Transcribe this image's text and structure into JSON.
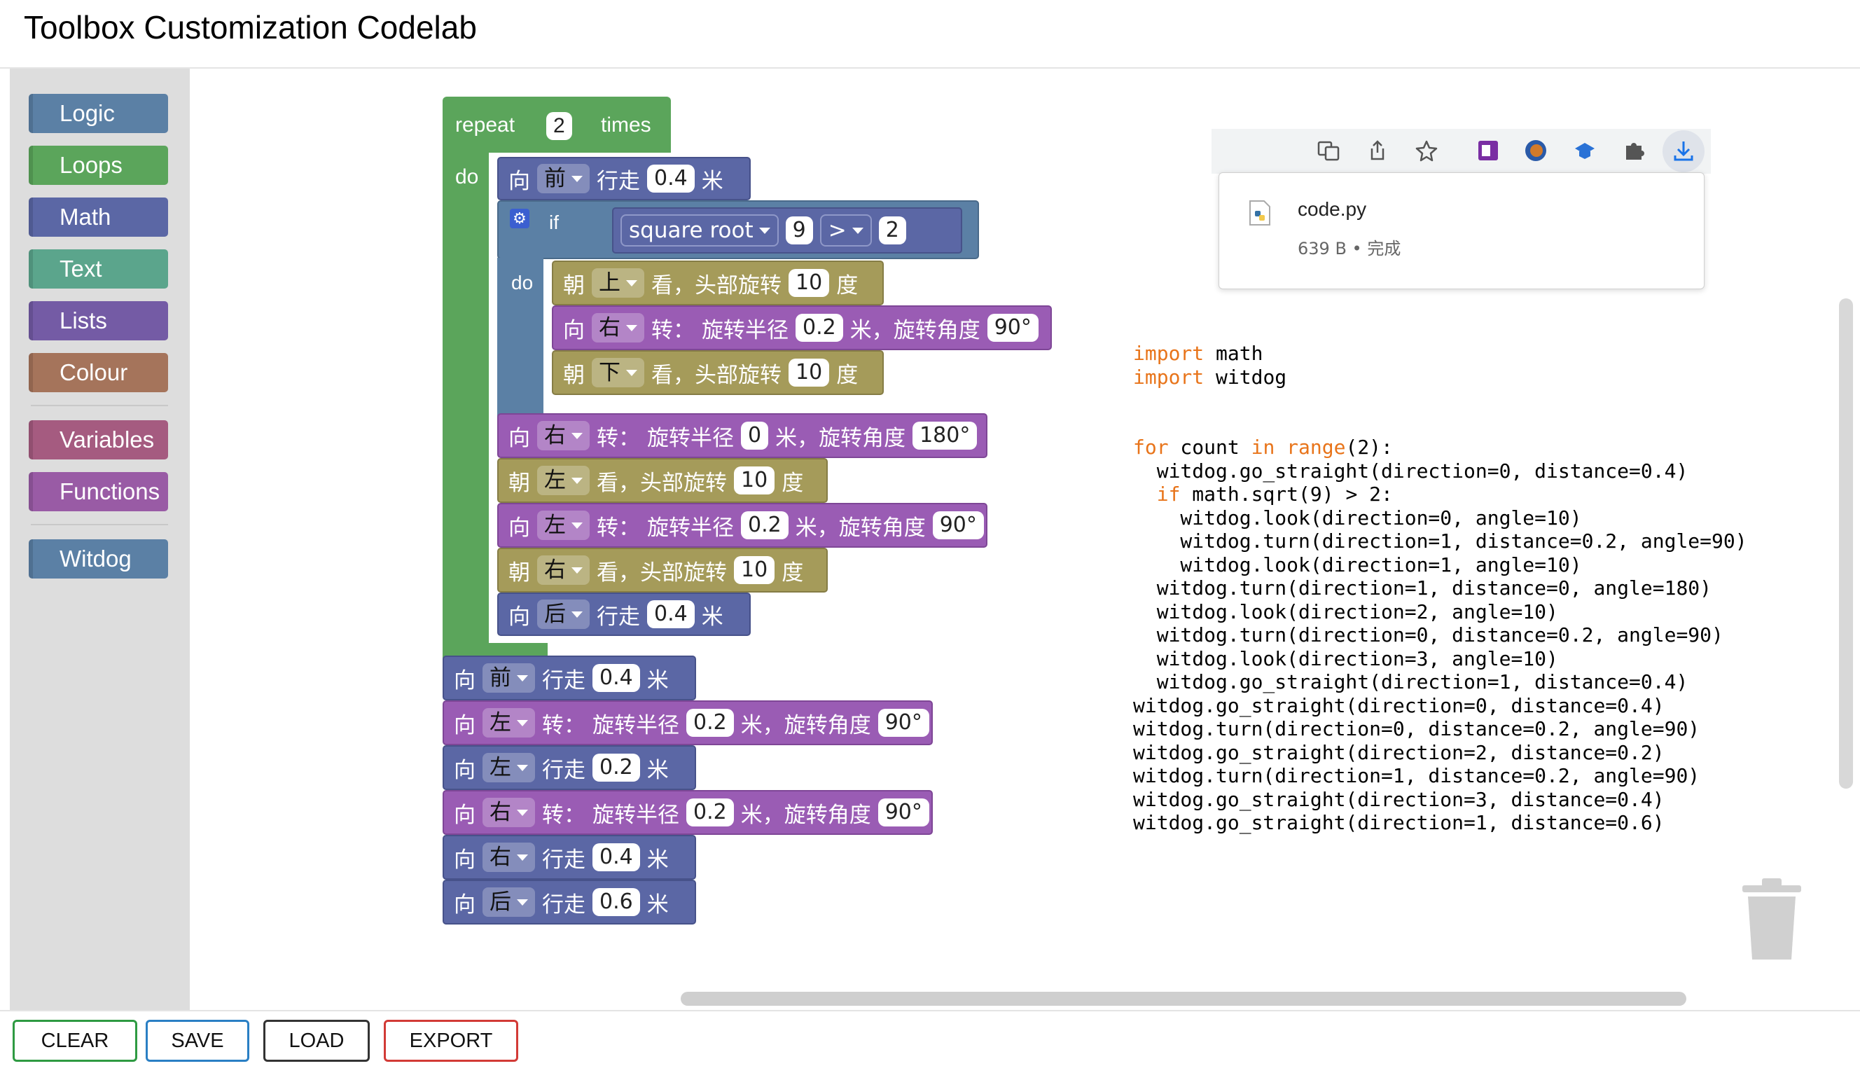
{
  "title": "Toolbox Customization Codelab",
  "toolbox": {
    "categories": [
      {
        "label": "Logic",
        "color": "#5b80a5"
      },
      {
        "label": "Loops",
        "color": "#5ba55b"
      },
      {
        "label": "Math",
        "color": "#5b67a5"
      },
      {
        "label": "Text",
        "color": "#5ba58c"
      },
      {
        "label": "Lists",
        "color": "#745ba5"
      },
      {
        "label": "Colour",
        "color": "#a5745b"
      },
      {
        "label": "Variables",
        "color": "#a55b80"
      },
      {
        "label": "Functions",
        "color": "#995ba5"
      },
      {
        "label": "Witdog",
        "color": "#5b80a5"
      }
    ]
  },
  "blocks": {
    "repeat": {
      "label_repeat": "repeat",
      "count": "2",
      "label_times": "times",
      "label_do": "do"
    },
    "if": {
      "label_if": "if",
      "label_do": "do",
      "func": "square root",
      "arg": "9",
      "op": ">",
      "rhs": "2"
    },
    "words": {
      "xiang": "向",
      "chao": "朝",
      "xingzou": "行走",
      "mi": "米",
      "kan_turn": "看，头部旋转",
      "du": "度",
      "zhuan": "转：",
      "radius": "旋转半径",
      "mi_angle": "米，旋转角度"
    },
    "rows": [
      {
        "dir": "前",
        "dist": "0.4"
      },
      {
        "dir": "上",
        "deg": "10"
      },
      {
        "dir": "右",
        "radius": "0.2",
        "angle": "90°"
      },
      {
        "dir": "下",
        "deg": "10"
      },
      {
        "dir": "右",
        "radius": "0",
        "angle": "180°"
      },
      {
        "dir": "左",
        "deg": "10"
      },
      {
        "dir": "左",
        "radius": "0.2",
        "angle": "90°"
      },
      {
        "dir": "右",
        "deg": "10"
      },
      {
        "dir": "后",
        "dist": "0.4"
      },
      {
        "dir": "前",
        "dist": "0.4"
      },
      {
        "dir": "左",
        "radius": "0.2",
        "angle": "90°"
      },
      {
        "dir": "左",
        "dist": "0.2"
      },
      {
        "dir": "右",
        "radius": "0.2",
        "angle": "90°"
      },
      {
        "dir": "右",
        "dist": "0.4"
      },
      {
        "dir": "后",
        "dist": "0.6"
      }
    ]
  },
  "download": {
    "filename": "code.py",
    "meta": "639 B • 完成"
  },
  "code_lines": [
    {
      "kw": "import",
      "rest": " math"
    },
    {
      "kw": "import",
      "rest": " witdog"
    },
    {
      "kw": "",
      "rest": ""
    },
    {
      "kw": "",
      "rest": ""
    },
    {
      "kw": "for",
      "rest": " count ",
      "kw2": "in",
      "kw3": " range",
      "rest2": "(2):"
    },
    {
      "kw": "",
      "rest": "  witdog.go_straight(direction=0, distance=0.4)"
    },
    {
      "pre": "  ",
      "kw": "if",
      "rest": " math.sqrt(9) > 2:"
    },
    {
      "kw": "",
      "rest": "    witdog.look(direction=0, angle=10)"
    },
    {
      "kw": "",
      "rest": "    witdog.turn(direction=1, distance=0.2, angle=90)"
    },
    {
      "kw": "",
      "rest": "    witdog.look(direction=1, angle=10)"
    },
    {
      "kw": "",
      "rest": "  witdog.turn(direction=1, distance=0, angle=180)"
    },
    {
      "kw": "",
      "rest": "  witdog.look(direction=2, angle=10)"
    },
    {
      "kw": "",
      "rest": "  witdog.turn(direction=0, distance=0.2, angle=90)"
    },
    {
      "kw": "",
      "rest": "  witdog.look(direction=3, angle=10)"
    },
    {
      "kw": "",
      "rest": "  witdog.go_straight(direction=1, distance=0.4)"
    },
    {
      "kw": "",
      "rest": "witdog.go_straight(direction=0, distance=0.4)"
    },
    {
      "kw": "",
      "rest": "witdog.turn(direction=0, distance=0.2, angle=90)"
    },
    {
      "kw": "",
      "rest": "witdog.go_straight(direction=2, distance=0.2)"
    },
    {
      "kw": "",
      "rest": "witdog.turn(direction=1, distance=0.2, angle=90)"
    },
    {
      "kw": "",
      "rest": "witdog.go_straight(direction=3, distance=0.4)"
    },
    {
      "kw": "",
      "rest": "witdog.go_straight(direction=1, distance=0.6)"
    }
  ],
  "buttons": {
    "clear": "CLEAR",
    "save": "SAVE",
    "load": "LOAD",
    "export": "EXPORT"
  },
  "button_colors": {
    "clear": "#2e9a42",
    "save": "#2a7fc4",
    "load": "#333333",
    "export": "#d23a36"
  },
  "icons": [
    "translate-icon",
    "share-icon",
    "star-icon",
    "onenote-icon",
    "profile-icon",
    "extension-cap-icon",
    "puzzle-icon",
    "download-icon",
    "python-file-icon",
    "gear-icon",
    "trash-icon"
  ]
}
